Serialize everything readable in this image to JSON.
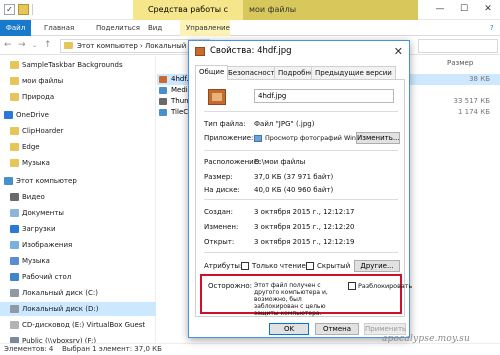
{
  "explorer": {
    "ribbon_contextual": "Средства работы с рисунками",
    "ribbon_title": "мои файлы",
    "tabs": {
      "file": "Файл",
      "home": "Главная",
      "share": "Поделиться",
      "view": "Вид",
      "manage": "Управление"
    },
    "address": "Этот компьютер › Локальный",
    "column_size": "Размер",
    "sidebar": [
      {
        "label": "SampleTaskbar Backgrounds",
        "icon": "folder-icon"
      },
      {
        "label": "мои файлы",
        "icon": "folder-icon"
      },
      {
        "label": "Природа",
        "icon": "folder-icon"
      },
      {
        "label": "OneDrive",
        "icon": "onedrive-icon"
      },
      {
        "label": "ClipHoarder",
        "icon": "folder-icon"
      },
      {
        "label": "Edge",
        "icon": "folder-icon"
      },
      {
        "label": "Музыка",
        "icon": "folder-icon"
      },
      {
        "label": "Этот компьютер",
        "icon": "computer-icon"
      },
      {
        "label": "Видео",
        "icon": "video-icon"
      },
      {
        "label": "Документы",
        "icon": "documents-icon"
      },
      {
        "label": "Загрузки",
        "icon": "downloads-icon"
      },
      {
        "label": "Изображения",
        "icon": "pictures-icon"
      },
      {
        "label": "Музыка",
        "icon": "music-icon"
      },
      {
        "label": "Рабочий стол",
        "icon": "desktop-icon"
      },
      {
        "label": "Локальный диск (C:)",
        "icon": "drive-icon"
      },
      {
        "label": "Локальный диск (D:)",
        "icon": "drive-icon"
      },
      {
        "label": "CD-дисковод (E:) VirtualBox Guest",
        "icon": "cd-icon"
      },
      {
        "label": "Public (\\\\vboxsrv) (F:)",
        "icon": "network-drive-icon"
      },
      {
        "label": "Сеть",
        "icon": "network-icon"
      }
    ],
    "files": [
      {
        "name": "4hdf.jpg",
        "size": "38 КБ"
      },
      {
        "name": "Media",
        "size": ""
      },
      {
        "name": "Thunc",
        "size": "33 517 КБ"
      },
      {
        "name": "TileCr",
        "size": "1 174 КБ"
      }
    ],
    "status": {
      "count": "Элементов: 4",
      "selected": "Выбран 1 элемент: 37,0 КБ"
    }
  },
  "dialog": {
    "title": "Свойства: 4hdf.jpg",
    "tabs": [
      "Общие",
      "Безопасность",
      "Подробно",
      "Предыдущие версии"
    ],
    "filename": "4hdf.jpg",
    "type_label": "Тип файла:",
    "type_value": "Файл \"JPG\" (.jpg)",
    "app_label": "Приложение:",
    "app_value": "Просмотр фотографий Windows",
    "change_button": "Изменить...",
    "location_label": "Расположение:",
    "location_value": "D:\\мои файлы",
    "size_label": "Размер:",
    "size_value": "37,0 КБ (37 971 байт)",
    "disk_label": "На диске:",
    "disk_value": "40,0 КБ (40 960 байт)",
    "created_label": "Создан:",
    "created_value": "3 октября 2015 г., 12:12:17",
    "modified_label": "Изменен:",
    "modified_value": "3 октября 2015 г., 12:12:20",
    "opened_label": "Открыт:",
    "opened_value": "3 октября 2015 г., 12:12:19",
    "attributes_label": "Атрибуты:",
    "readonly_label": "Только чтение",
    "hidden_label": "Скрытый",
    "other_button": "Другие...",
    "security_label": "Осторожно:",
    "security_text": "Этот файл получен с другого компьютера и, возможно, был заблокирован с целью защиты компьютера.",
    "unblock_label": "Разблокировать",
    "ok_button": "OK",
    "cancel_button": "Отмена",
    "apply_button": "Применить"
  },
  "watermark": "apocalypse.moy.su"
}
